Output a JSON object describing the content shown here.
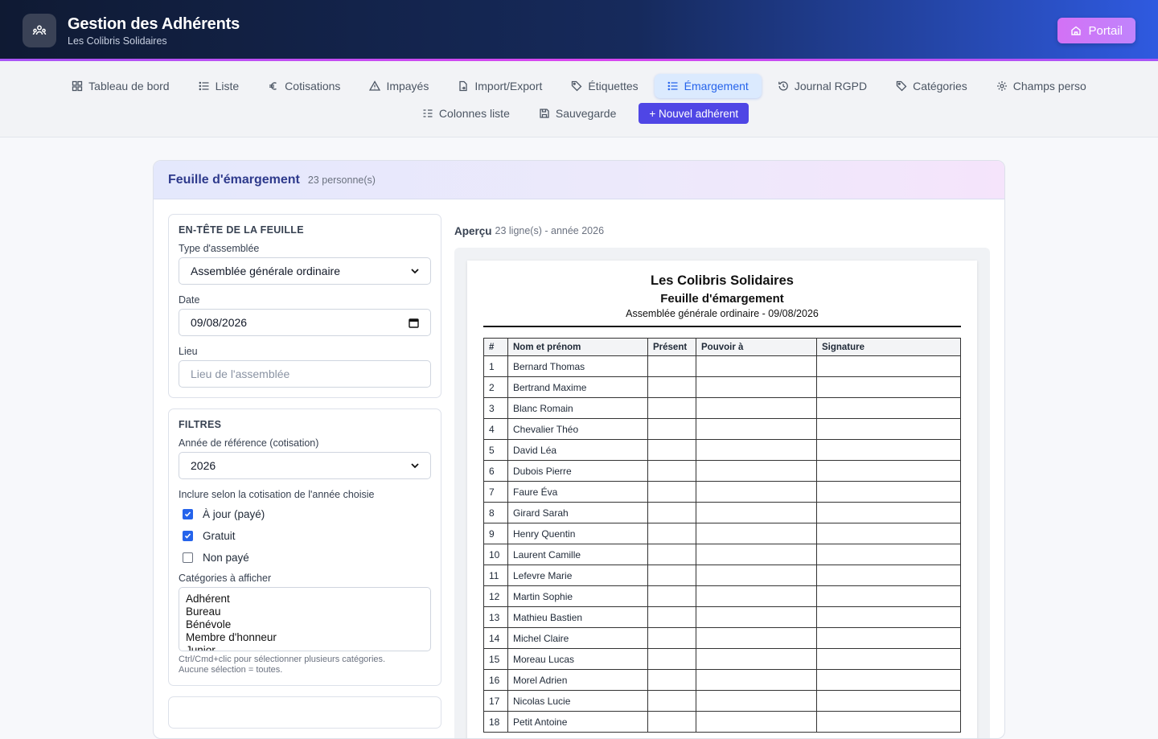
{
  "app": {
    "title": "Gestion des Adhérents",
    "subtitle": "Les Colibris Solidaires",
    "portal_label": "Portail"
  },
  "nav": {
    "row1": [
      {
        "label": "Tableau de bord",
        "icon": "dashboard-icon"
      },
      {
        "label": "Liste",
        "icon": "list-icon"
      },
      {
        "label": "Cotisations",
        "icon": "euro-icon"
      },
      {
        "label": "Impayés",
        "icon": "warning-icon"
      },
      {
        "label": "Import/Export",
        "icon": "file-transfer-icon"
      },
      {
        "label": "Étiquettes",
        "icon": "tag-icon"
      },
      {
        "label": "Émargement",
        "icon": "list-icon",
        "active": true
      },
      {
        "label": "Journal RGPD",
        "icon": "history-icon"
      },
      {
        "label": "Catégories",
        "icon": "tag-icon"
      },
      {
        "label": "Champs perso",
        "icon": "gear-icon"
      }
    ],
    "row2": [
      {
        "label": "Colonnes liste",
        "icon": "columns-icon"
      },
      {
        "label": "Sauvegarde",
        "icon": "save-icon"
      }
    ],
    "new_member": "+ Nouvel adhérent"
  },
  "card": {
    "title": "Feuille d'émargement",
    "count": "23 personne(s)"
  },
  "header_panel": {
    "title": "EN-TÊTE DE LA FEUILLE",
    "type_label": "Type d'assemblée",
    "type_value": "Assemblée générale ordinaire",
    "date_label": "Date",
    "date_value": "09/08/2026",
    "lieu_label": "Lieu",
    "lieu_placeholder": "Lieu de l'assemblée"
  },
  "filters": {
    "title": "FILTRES",
    "year_label": "Année de référence (cotisation)",
    "year_value": "2026",
    "include_label": "Inclure selon la cotisation de l'année choisie",
    "checks": [
      {
        "label": "À jour (payé)",
        "checked": true
      },
      {
        "label": "Gratuit",
        "checked": true
      },
      {
        "label": "Non payé",
        "checked": false
      }
    ],
    "categories_label": "Catégories à afficher",
    "categories": [
      "Adhérent",
      "Bureau",
      "Bénévole",
      "Membre d'honneur",
      "Junior"
    ],
    "hint1": "Ctrl/Cmd+clic pour sélectionner plusieurs catégories.",
    "hint2": "Aucune sélection = toutes."
  },
  "preview": {
    "label": "Aperçu",
    "meta": "23 ligne(s) - année 2026",
    "org": "Les Colibris Solidaires",
    "title": "Feuille d'émargement",
    "subtitle": "Assemblée générale ordinaire - 09/08/2026",
    "columns": [
      "#",
      "Nom et prénom",
      "Présent",
      "Pouvoir à",
      "Signature"
    ],
    "rows": [
      [
        "1",
        "Bernard Thomas"
      ],
      [
        "2",
        "Bertrand Maxime"
      ],
      [
        "3",
        "Blanc Romain"
      ],
      [
        "4",
        "Chevalier Théo"
      ],
      [
        "5",
        "David Léa"
      ],
      [
        "6",
        "Dubois Pierre"
      ],
      [
        "7",
        "Faure Éva"
      ],
      [
        "8",
        "Girard Sarah"
      ],
      [
        "9",
        "Henry Quentin"
      ],
      [
        "10",
        "Laurent Camille"
      ],
      [
        "11",
        "Lefevre Marie"
      ],
      [
        "12",
        "Martin Sophie"
      ],
      [
        "13",
        "Mathieu Bastien"
      ],
      [
        "14",
        "Michel Claire"
      ],
      [
        "15",
        "Moreau Lucas"
      ],
      [
        "16",
        "Morel Adrien"
      ],
      [
        "17",
        "Nicolas Lucie"
      ],
      [
        "18",
        "Petit Antoine"
      ]
    ]
  }
}
